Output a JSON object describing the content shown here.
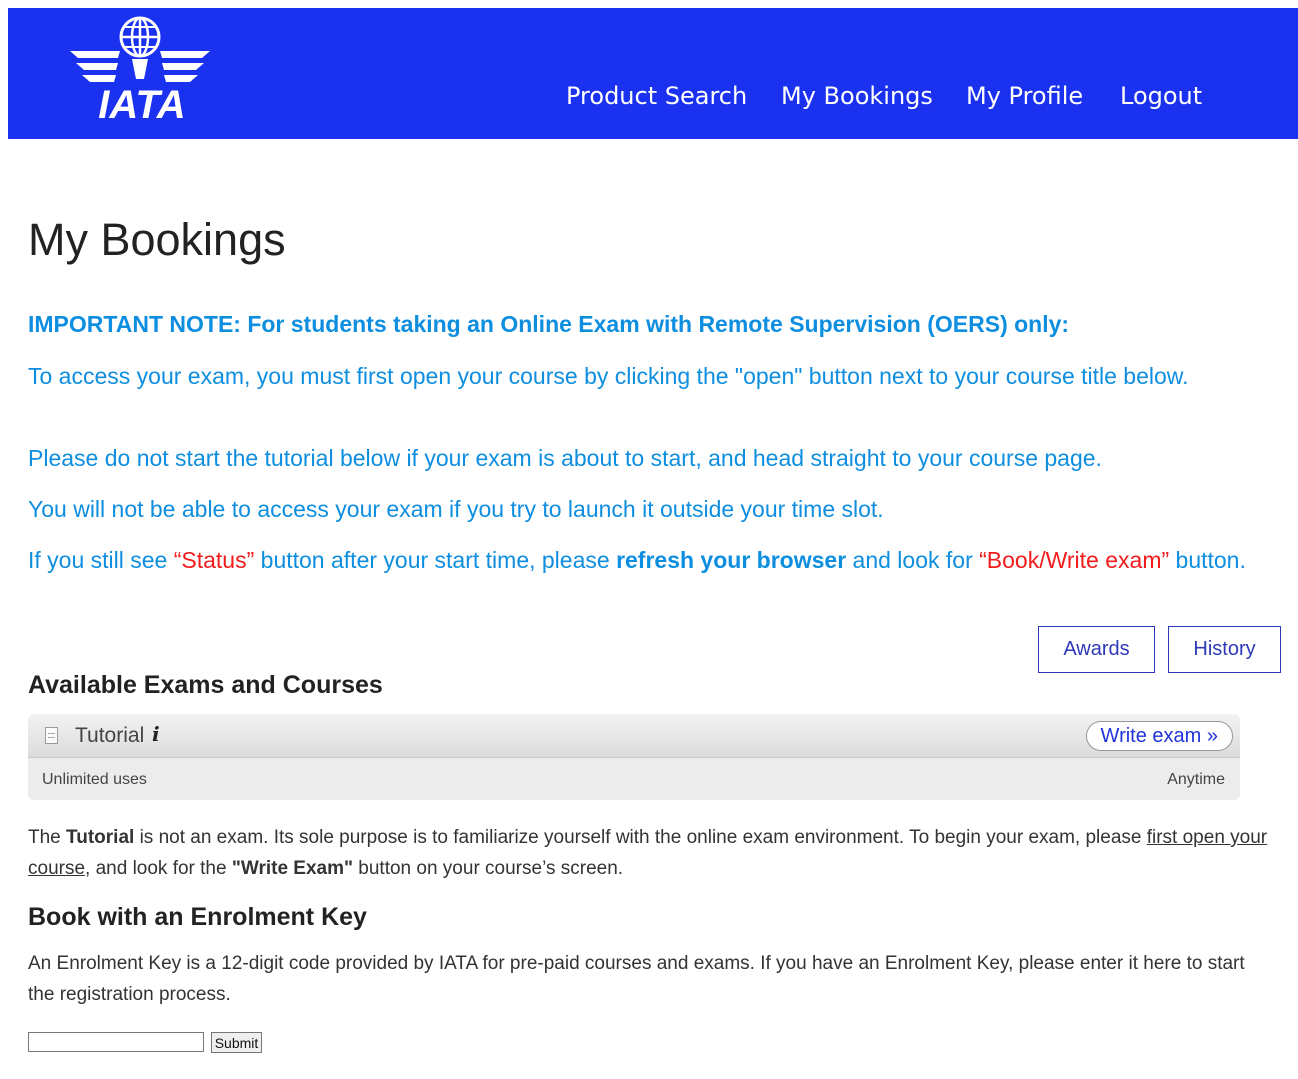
{
  "brand": {
    "logo_text": "IATA",
    "primary_color": "#1a31f0"
  },
  "nav": {
    "items": [
      "Product Search",
      "My Bookings",
      "My Profile",
      "Logout"
    ]
  },
  "page": {
    "title": "My Bookings"
  },
  "notice": {
    "title": "IMPORTANT NOTE: For students taking an Online Exam with Remote Supervision (OERS) only:",
    "line1": "To access your exam, you must first open your course by clicking the \"open\" button next to your course title below.",
    "line2": "Please do not start the tutorial below if your exam is about to start, and head straight to your course page.",
    "line3": "You will not be able to access your exam if you try to launch it outside your time slot.",
    "line4_a": "If you still see ",
    "line4_status": "“Status”",
    "line4_b": " button after your start time, please ",
    "line4_refresh": "refresh your browser",
    "line4_c": " and look for ",
    "line4_book": "“Book/Write exam”",
    "line4_d": " button."
  },
  "actions": {
    "awards_label": "Awards",
    "history_label": "History"
  },
  "available": {
    "heading": "Available Exams and Courses",
    "item": {
      "name": "Tutorial",
      "info_icon": "i",
      "button": "Write exam »",
      "uses": "Unlimited uses",
      "availability": "Anytime"
    }
  },
  "tutorial_note": {
    "a": "The ",
    "b": "Tutorial",
    "c": " is not an exam. Its sole purpose is to familiarize yourself with the online exam environment. To begin your exam, please ",
    "link": "first open your course",
    "d": ", and look for the ",
    "e": "\"Write Exam\"",
    "f": " button on your course’s screen."
  },
  "enrolment": {
    "heading": "Book with an Enrolment Key",
    "text": "An Enrolment Key is a 12-digit code provided by IATA for pre-paid courses and exams. If you have an Enrolment Key, please enter it here to start the registration process.",
    "input_value": "",
    "submit_label": "Submit"
  }
}
